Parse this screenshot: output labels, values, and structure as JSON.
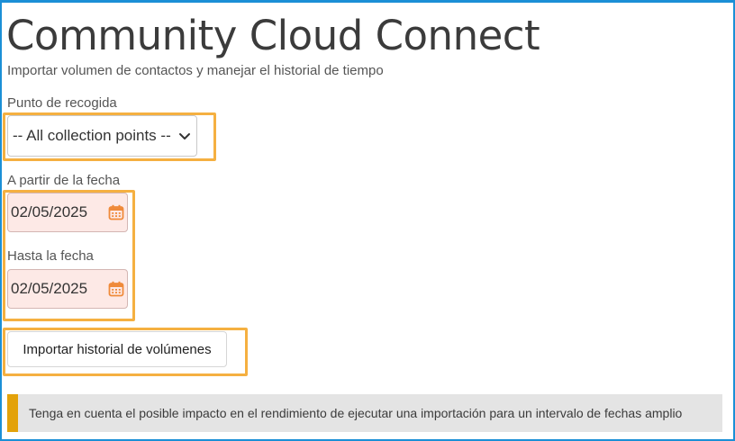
{
  "header": {
    "title": "Community Cloud Connect",
    "subtitle": "Importar volumen de contactos y manejar el historial de tiempo"
  },
  "pickup": {
    "label": "Punto de recogida",
    "selected": "-- All collection points --"
  },
  "from_date": {
    "label": "A partir de la fecha",
    "value": "02/05/2025"
  },
  "to_date": {
    "label": "Hasta la fecha",
    "value": "02/05/2025"
  },
  "import_button": {
    "label": "Importar historial de volúmenes"
  },
  "notice": {
    "text": "Tenga en cuenta el posible impacto en el rendimiento de ejecutar una importación para un intervalo de fechas amplio"
  },
  "colors": {
    "frame_border": "#1b8fd6",
    "highlight": "#f5b041",
    "date_background": "#fde9e6",
    "calendar_icon": "#ef8a3a",
    "notice_accent": "#e3a20a",
    "notice_background": "#e4e4e4"
  },
  "icons": {
    "select_chevron": "chevron-down-icon",
    "date_picker": "calendar-icon"
  }
}
